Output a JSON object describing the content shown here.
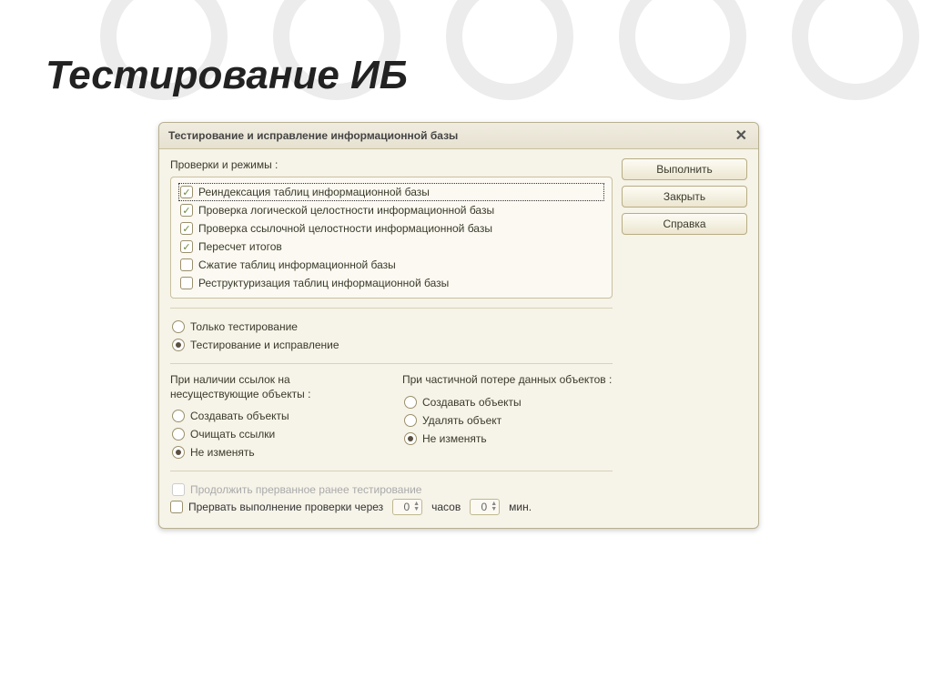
{
  "slide_title": "Тестирование ИБ",
  "dialog": {
    "title": "Тестирование и исправление информационной базы",
    "buttons": {
      "execute": "Выполнить",
      "close": "Закрыть",
      "help": "Справка"
    },
    "checks_label": "Проверки и режимы :",
    "checks": [
      {
        "label": "Реиндексация таблиц информационной базы",
        "checked": true
      },
      {
        "label": "Проверка логической целостности информационной базы",
        "checked": true
      },
      {
        "label": "Проверка ссылочной целостности информационной базы",
        "checked": true
      },
      {
        "label": "Пересчет итогов",
        "checked": true
      },
      {
        "label": "Сжатие таблиц информационной базы",
        "checked": false
      },
      {
        "label": "Реструктуризация таблиц информационной базы",
        "checked": false
      }
    ],
    "mode": {
      "options": [
        {
          "label": "Только тестирование",
          "selected": false
        },
        {
          "label": "Тестирование и исправление",
          "selected": true
        }
      ]
    },
    "missing_refs": {
      "label": "При наличии ссылок на несуществующие объекты :",
      "options": [
        {
          "label": "Создавать объекты",
          "selected": false
        },
        {
          "label": "Очищать ссылки",
          "selected": false
        },
        {
          "label": "Не изменять",
          "selected": true
        }
      ]
    },
    "partial_loss": {
      "label": "При частичной потере данных объектов :",
      "options": [
        {
          "label": "Создавать объекты",
          "selected": false
        },
        {
          "label": "Удалять объект",
          "selected": false
        },
        {
          "label": "Не изменять",
          "selected": true
        }
      ]
    },
    "continue_check": {
      "label": "Продолжить прерванное ранее тестирование",
      "checked": false,
      "disabled": true
    },
    "interrupt": {
      "label": "Прервать выполнение проверки через",
      "checked": false,
      "hours": "0",
      "hours_unit": "часов",
      "mins": "0",
      "mins_unit": "мин."
    }
  }
}
